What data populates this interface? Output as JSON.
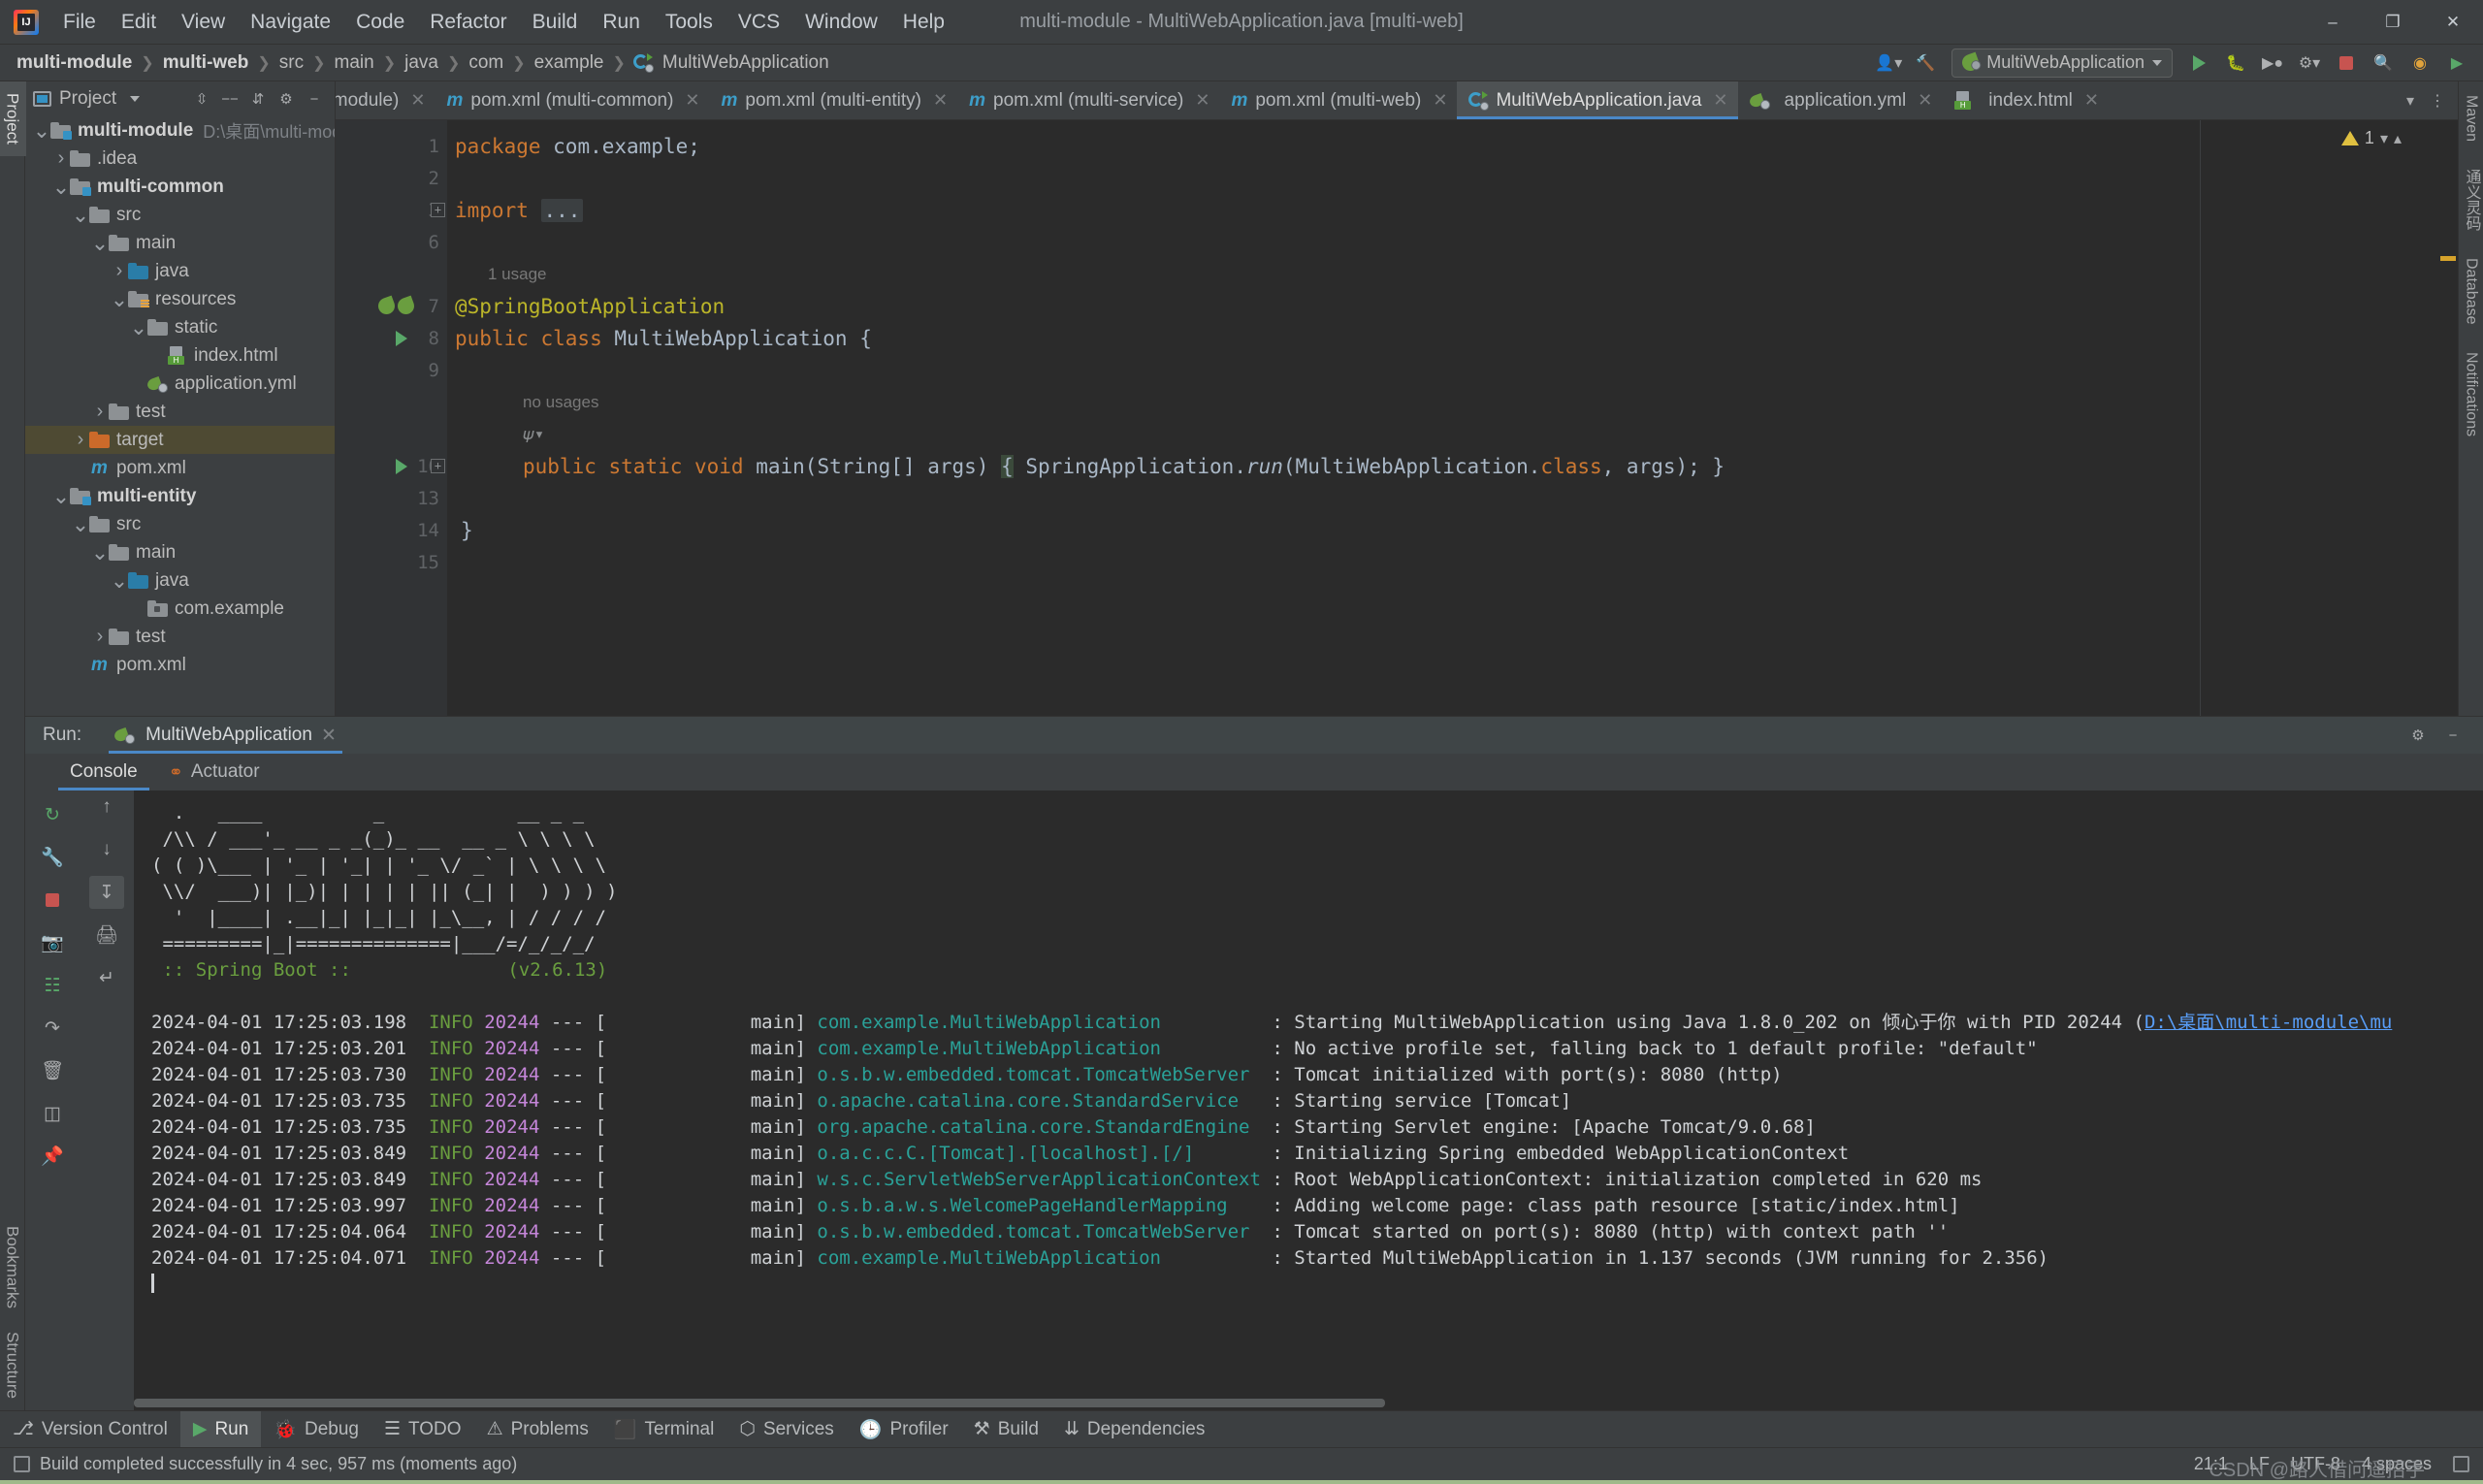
{
  "window": {
    "title": "multi-module - MultiWebApplication.java [multi-web]",
    "minimize": "–",
    "maximize": "❐",
    "close": "✕",
    "logo_text": "IJ"
  },
  "menubar": [
    "File",
    "Edit",
    "View",
    "Navigate",
    "Code",
    "Refactor",
    "Build",
    "Run",
    "Tools",
    "VCS",
    "Window",
    "Help"
  ],
  "breadcrumb": [
    {
      "label": "multi-module",
      "bold": true
    },
    {
      "label": "multi-web",
      "bold": true
    },
    {
      "label": "src",
      "bold": false
    },
    {
      "label": "main",
      "bold": false
    },
    {
      "label": "java",
      "bold": false
    },
    {
      "label": "com",
      "bold": false
    },
    {
      "label": "example",
      "bold": false
    },
    {
      "label": "MultiWebApplication",
      "bold": false,
      "icon": "spring-class-icon"
    }
  ],
  "navbar_right": {
    "run_config": "MultiWebApplication",
    "buttons": [
      "user-icon",
      "hammer-build-icon",
      "run-icon",
      "debug-icon",
      "run-with-coverage-icon",
      "profiler-icon",
      "stop-icon",
      "search-icon",
      "updates-icon",
      "ide-icon"
    ]
  },
  "project_panel": {
    "title": "Project",
    "header_icons": [
      "collapse-all-icon",
      "expand-all-icon",
      "sort-icon",
      "settings-gear-icon",
      "hide-icon"
    ],
    "tree": [
      {
        "depth": 0,
        "label": "multi-module",
        "bold": true,
        "arrow": "down",
        "icon": "module-folder",
        "path": "D:\\桌面\\multi-module"
      },
      {
        "depth": 1,
        "label": ".idea",
        "bold": false,
        "arrow": "right",
        "icon": "folder"
      },
      {
        "depth": 1,
        "label": "multi-common",
        "bold": true,
        "arrow": "down",
        "icon": "module-folder"
      },
      {
        "depth": 2,
        "label": "src",
        "bold": false,
        "arrow": "down",
        "icon": "folder"
      },
      {
        "depth": 3,
        "label": "main",
        "bold": false,
        "arrow": "down",
        "icon": "folder"
      },
      {
        "depth": 4,
        "label": "java",
        "bold": false,
        "arrow": "right",
        "icon": "source-folder"
      },
      {
        "depth": 4,
        "label": "resources",
        "bold": false,
        "arrow": "down",
        "icon": "resources-folder"
      },
      {
        "depth": 5,
        "label": "static",
        "bold": false,
        "arrow": "down",
        "icon": "folder"
      },
      {
        "depth": 6,
        "label": "index.html",
        "bold": false,
        "arrow": "none",
        "icon": "html-file"
      },
      {
        "depth": 5,
        "label": "application.yml",
        "bold": false,
        "arrow": "none",
        "icon": "spring-yaml-file"
      },
      {
        "depth": 3,
        "label": "test",
        "bold": false,
        "arrow": "right",
        "icon": "folder"
      },
      {
        "depth": 2,
        "label": "target",
        "bold": false,
        "arrow": "right",
        "icon": "excluded-folder",
        "selected": true
      },
      {
        "depth": 2,
        "label": "pom.xml",
        "bold": false,
        "arrow": "none",
        "icon": "maven-file"
      },
      {
        "depth": 1,
        "label": "multi-entity",
        "bold": true,
        "arrow": "down",
        "icon": "module-folder"
      },
      {
        "depth": 2,
        "label": "src",
        "bold": false,
        "arrow": "down",
        "icon": "folder"
      },
      {
        "depth": 3,
        "label": "main",
        "bold": false,
        "arrow": "down",
        "icon": "folder"
      },
      {
        "depth": 4,
        "label": "java",
        "bold": false,
        "arrow": "down",
        "icon": "source-folder"
      },
      {
        "depth": 5,
        "label": "com.example",
        "bold": false,
        "arrow": "none",
        "icon": "package"
      },
      {
        "depth": 3,
        "label": "test",
        "bold": false,
        "arrow": "right",
        "icon": "folder"
      },
      {
        "depth": 2,
        "label": "pom.xml",
        "bold": false,
        "arrow": "none",
        "icon": "maven-file"
      }
    ]
  },
  "editor_tabs": [
    {
      "label": "pom.xml (multi-module)",
      "icon": "maven-file",
      "active": false,
      "truncated": true
    },
    {
      "label": "pom.xml (multi-common)",
      "icon": "maven-file",
      "active": false
    },
    {
      "label": "pom.xml (multi-entity)",
      "icon": "maven-file",
      "active": false
    },
    {
      "label": "pom.xml (multi-service)",
      "icon": "maven-file",
      "active": false
    },
    {
      "label": "pom.xml (multi-web)",
      "icon": "maven-file",
      "active": false
    },
    {
      "label": "MultiWebApplication.java",
      "icon": "spring-class-icon",
      "active": true
    },
    {
      "label": "application.yml",
      "icon": "spring-yaml-file",
      "active": false
    },
    {
      "label": "index.html",
      "icon": "html-file",
      "active": false
    }
  ],
  "editor": {
    "warning_count": "1",
    "lines": [
      {
        "num": "1",
        "gutter": [],
        "fold": false
      },
      {
        "num": "2",
        "gutter": [],
        "fold": false
      },
      {
        "num": "3",
        "gutter": [],
        "fold": true
      },
      {
        "num": "6",
        "gutter": [],
        "fold": false
      },
      {
        "num": "",
        "gutter": [],
        "fold": false
      },
      {
        "num": "7",
        "gutter": [
          "leaf-run-icon",
          "leaf-check-icon"
        ],
        "fold": false
      },
      {
        "num": "8",
        "gutter": [
          "run-triangle-icon"
        ],
        "fold": false
      },
      {
        "num": "9",
        "gutter": [],
        "fold": false
      },
      {
        "num": "",
        "gutter": [],
        "fold": false
      },
      {
        "num": "",
        "gutter": [],
        "fold": false
      },
      {
        "num": "10",
        "gutter": [
          "run-triangle-icon"
        ],
        "fold": true
      },
      {
        "num": "13",
        "gutter": [],
        "fold": false
      },
      {
        "num": "14",
        "gutter": [],
        "fold": false
      },
      {
        "num": "15",
        "gutter": [],
        "fold": false
      }
    ],
    "code": {
      "l1_kw": "package",
      "l1_rest": " com.example;",
      "l3_kw": "import",
      "l3_fold": "...",
      "l6_hint": "1 usage",
      "l7_annotation": "@SpringBootApplication",
      "l8_kw1": "public class",
      "l8_name": " MultiWebApplication {",
      "l9_hint": "no usages",
      "l10_a": "public static void",
      "l10_b": " main",
      "l10_c": "(String[] args) ",
      "l10_brace": "{",
      "l10_d": " SpringApplication.",
      "l10_run": "run",
      "l10_e": "(MultiWebApplication.",
      "l10_class": "class",
      "l10_f": ", args); }",
      "l14_close": "}"
    }
  },
  "run_panel": {
    "label": "Run:",
    "tab_name": "MultiWebApplication",
    "tab_close": "✕",
    "settings_icon": "gear-icon",
    "minimize_icon": "minimize-icon",
    "left_tools": [
      "rerun-icon",
      "up-arrow-icon",
      "stop-icon",
      "down-arrow-icon",
      "camera-icon",
      "scroll-to-end-icon",
      "thread-dump-icon",
      "print-icon",
      "soft-wrap-icon",
      "clear-all-icon",
      "pin-icon"
    ],
    "console_tabs": [
      {
        "label": "Console",
        "active": true
      },
      {
        "label": "Actuator",
        "active": false,
        "icon": "actuator-icon"
      }
    ],
    "banner": [
      "  .   ____          _            __ _ _",
      " /\\\\ / ___'_ __ _ _(_)_ __  __ _ \\ \\ \\ \\",
      "( ( )\\___ | '_ | '_| | '_ \\/ _` | \\ \\ \\ \\",
      " \\\\/  ___)| |_)| | | | | || (_| |  ) ) ) )",
      "  '  |____| .__|_| |_|_| |_\\__, | / / / /",
      " =========|_|==============|___/=/_/_/_/"
    ],
    "banner_footer_left": " :: Spring Boot :: ",
    "banner_footer_right": "(v2.6.13)",
    "log_lines": [
      {
        "ts": "2024-04-01 17:25:03.198",
        "level": "INFO",
        "pid": "20244",
        "thread": "main",
        "logger": "com.example.MultiWebApplication",
        "msg": ": Starting MultiWebApplication using Java 1.8.0_202 on 倾心于你 with PID 20244 (",
        "link": "D:\\桌面\\multi-module\\mu"
      },
      {
        "ts": "2024-04-01 17:25:03.201",
        "level": "INFO",
        "pid": "20244",
        "thread": "main",
        "logger": "com.example.MultiWebApplication",
        "msg": ": No active profile set, falling back to 1 default profile: \"default\""
      },
      {
        "ts": "2024-04-01 17:25:03.730",
        "level": "INFO",
        "pid": "20244",
        "thread": "main",
        "logger": "o.s.b.w.embedded.tomcat.TomcatWebServer",
        "msg": ": Tomcat initialized with port(s): 8080 (http)"
      },
      {
        "ts": "2024-04-01 17:25:03.735",
        "level": "INFO",
        "pid": "20244",
        "thread": "main",
        "logger": "o.apache.catalina.core.StandardService",
        "msg": ": Starting service [Tomcat]"
      },
      {
        "ts": "2024-04-01 17:25:03.735",
        "level": "INFO",
        "pid": "20244",
        "thread": "main",
        "logger": "org.apache.catalina.core.StandardEngine",
        "msg": ": Starting Servlet engine: [Apache Tomcat/9.0.68]"
      },
      {
        "ts": "2024-04-01 17:25:03.849",
        "level": "INFO",
        "pid": "20244",
        "thread": "main",
        "logger": "o.a.c.c.C.[Tomcat].[localhost].[/]",
        "msg": ": Initializing Spring embedded WebApplicationContext"
      },
      {
        "ts": "2024-04-01 17:25:03.849",
        "level": "INFO",
        "pid": "20244",
        "thread": "main",
        "logger": "w.s.c.ServletWebServerApplicationContext",
        "msg": ": Root WebApplicationContext: initialization completed in 620 ms"
      },
      {
        "ts": "2024-04-01 17:25:03.997",
        "level": "INFO",
        "pid": "20244",
        "thread": "main",
        "logger": "o.s.b.a.w.s.WelcomePageHandlerMapping",
        "msg": ": Adding welcome page: class path resource [static/index.html]"
      },
      {
        "ts": "2024-04-01 17:25:04.064",
        "level": "INFO",
        "pid": "20244",
        "thread": "main",
        "logger": "o.s.b.w.embedded.tomcat.TomcatWebServer",
        "msg": ": Tomcat started on port(s): 8080 (http) with context path ''"
      },
      {
        "ts": "2024-04-01 17:25:04.071",
        "level": "INFO",
        "pid": "20244",
        "thread": "main",
        "logger": "com.example.MultiWebApplication",
        "msg": ": Started MultiWebApplication in 1.137 seconds (JVM running for 2.356)"
      }
    ]
  },
  "left_strip": [
    {
      "label": "Project",
      "selected": true
    },
    {
      "label": "Bookmarks",
      "selected": false
    },
    {
      "label": "Structure",
      "selected": false
    }
  ],
  "right_strip": [
    {
      "label": "Maven"
    },
    {
      "label": "通义灵码"
    },
    {
      "label": "Database"
    },
    {
      "label": "Notifications"
    }
  ],
  "bottom_tabs": [
    {
      "label": "Version Control",
      "icon": "branch-icon",
      "selected": false
    },
    {
      "label": "Run",
      "icon": "run-icon",
      "selected": true
    },
    {
      "label": "Debug",
      "icon": "debug-icon",
      "selected": false
    },
    {
      "label": "TODO",
      "icon": "todo-icon",
      "selected": false
    },
    {
      "label": "Problems",
      "icon": "problems-icon",
      "selected": false
    },
    {
      "label": "Terminal",
      "icon": "terminal-icon",
      "selected": false
    },
    {
      "label": "Services",
      "icon": "services-icon",
      "selected": false
    },
    {
      "label": "Profiler",
      "icon": "profiler-icon",
      "selected": false
    },
    {
      "label": "Build",
      "icon": "build-icon",
      "selected": false
    },
    {
      "label": "Dependencies",
      "icon": "dependencies-icon",
      "selected": false
    }
  ],
  "statusbar": {
    "message": "Build completed successfully in 4 sec, 957 ms (moments ago)",
    "caret_position": "21:1",
    "line_separator": "LF",
    "encoding": "UTF-8",
    "indent": "4 spaces",
    "watermark": "CSDN @路人借问遥招手"
  },
  "colors": {
    "accent": "#4a88c7",
    "panel_bg": "#3c3f41",
    "editor_bg": "#2b2b2b",
    "selection": "#4e4a33",
    "green": "#6a9e3f",
    "keyword": "#cc7832",
    "annotation": "#bbb529",
    "logger": "#2aa198",
    "pid": "#c586d9",
    "link": "#589df6"
  }
}
